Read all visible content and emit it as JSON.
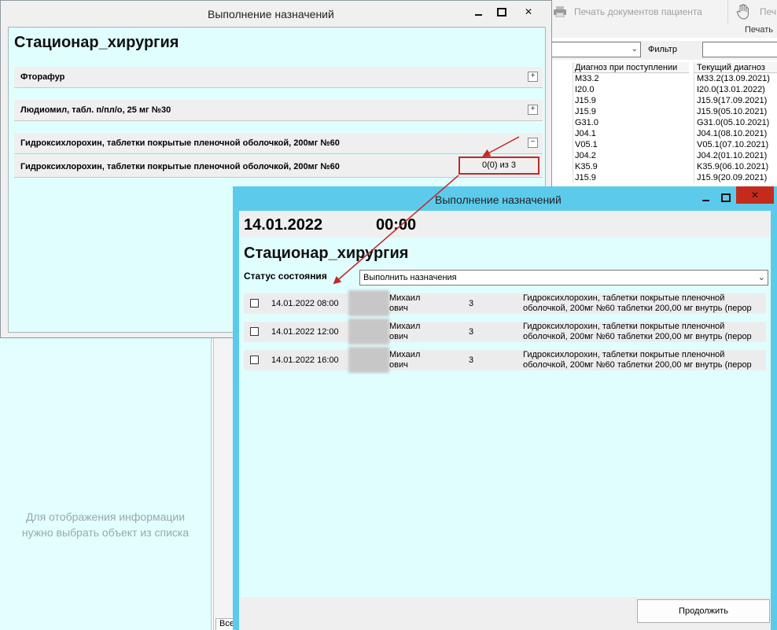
{
  "background": {
    "toolbar": {
      "print_docs_label": "Печать документов пациента",
      "print_short_label": "Печ",
      "print_group_label": "Печать"
    },
    "filter": {
      "label": "Фильтр"
    },
    "grid": {
      "headers": [
        "Диагноз при поступлении",
        "Текущий диагноз"
      ],
      "rows": [
        [
          "M33.2",
          "M33.2(13.09.2021)"
        ],
        [
          "I20.0",
          "I20.0(13.01.2022)"
        ],
        [
          "J15.9",
          "J15.9(17.09.2021)"
        ],
        [
          "J15.9",
          "J15.9(05.10.2021)"
        ],
        [
          "G31.0",
          "G31.0(05.10.2021)"
        ],
        [
          "J04.1",
          "J04.1(08.10.2021)"
        ],
        [
          "V05.1",
          "V05.1(07.10.2021)"
        ],
        [
          "J04.2",
          "J04.2(01.10.2021)"
        ],
        [
          "K35.9",
          "K35.9(06.10.2021)"
        ],
        [
          "J15.9",
          "J15.9(20.09.2021)"
        ]
      ]
    },
    "left_panel": {
      "empty_line1": "Для отображения информации",
      "empty_line2": "нужно выбрать объект из списка"
    },
    "mid_tab": "Все"
  },
  "window1": {
    "title": "Выполнение назначений",
    "department": "Стационар_хирургия",
    "drugs": [
      {
        "name": "Фторафур",
        "toggle": "+"
      },
      {
        "name": "Людиомил, табл. п/пл/о, 25 мг №30",
        "toggle": "+"
      },
      {
        "name": "Гидроксихлорохин, таблетки покрытые пленочной оболочкой, 200мг №60",
        "toggle": "−"
      }
    ],
    "sub_item": {
      "name": "Гидроксихлорохин, таблетки покрытые пленочной оболочкой, 200мг №60",
      "count": "0(0) из 3"
    }
  },
  "window2": {
    "title": "Выполнение назначений",
    "date": "14.01.2022",
    "time": "00:00",
    "department": "Стационар_хирургия",
    "status_label": "Статус состояния",
    "status_value": "Выполнить назначения",
    "rows": [
      {
        "datetime": "14.01.2022 08:00",
        "name_line1": "Михаил",
        "name_line2": "ович",
        "qty": "3",
        "desc": "Гидроксихлорохин, таблетки покрытые пленочной оболочкой, 200мг №60 таблетки 200,00 мг  внутрь (перор"
      },
      {
        "datetime": "14.01.2022 12:00",
        "name_line1": "Михаил",
        "name_line2": "ович",
        "qty": "3",
        "desc": "Гидроксихлорохин, таблетки покрытые пленочной оболочкой, 200мг №60 таблетки 200,00 мг  внутрь (перор"
      },
      {
        "datetime": "14.01.2022 16:00",
        "name_line1": "Михаил",
        "name_line2": "ович",
        "qty": "3",
        "desc": "Гидроксихлорохин, таблетки покрытые пленочной оболочкой, 200мг №60 таблетки 200,00 мг  внутрь (перор"
      }
    ],
    "continue_label": "Продолжить"
  },
  "colors": {
    "window2_frame": "#5ccbeb",
    "content_bg": "#e0fefe",
    "annotation_red": "#c0282a"
  }
}
